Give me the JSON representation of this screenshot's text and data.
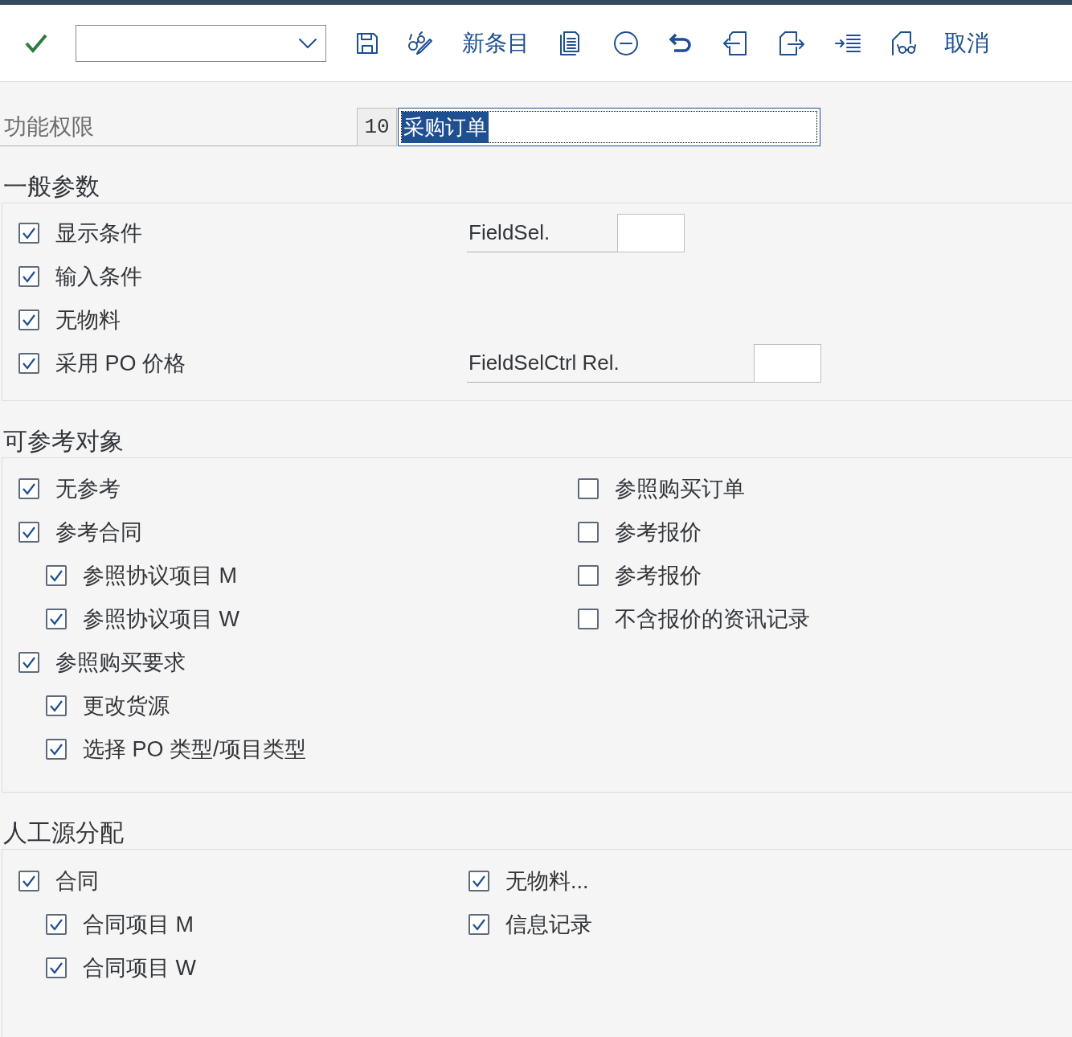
{
  "toolbar": {
    "new_entry": "新条目",
    "cancel": "取消"
  },
  "authority": {
    "label": "功能权限",
    "code": "10",
    "value": "采购订单",
    "text_selected": true
  },
  "sections": [
    {
      "title": "一般参数",
      "rows": [
        {
          "checkbox": {
            "label": "显示条件",
            "checked": true
          },
          "field": {
            "label": "FieldSel."
          }
        },
        {
          "checkbox": {
            "label": "输入条件",
            "checked": true
          }
        },
        {
          "checkbox": {
            "label": "无物料",
            "checked": true
          }
        },
        {
          "checkbox": {
            "label": "采用 PO 价格",
            "checked": true
          },
          "field": {
            "label": "FieldSelCtrl Rel."
          }
        }
      ]
    },
    {
      "title": "可参考对象",
      "left": [
        {
          "label": "无参考",
          "checked": true
        },
        {
          "label": "参考合同",
          "checked": true,
          "children": [
            {
              "label": "参照协议项目 M",
              "checked": true
            },
            {
              "label": "参照协议项目 W",
              "checked": true
            }
          ]
        },
        {
          "label": "参照购买要求",
          "checked": true,
          "children": [
            {
              "label": "更改货源",
              "checked": true
            },
            {
              "label": "选择 PO 类型/项目类型",
              "checked": true
            }
          ]
        }
      ],
      "right": [
        {
          "label": "参照购买订单",
          "checked": false
        },
        {
          "label": "参考报价",
          "checked": false
        },
        {
          "label": "参考报价",
          "checked": false
        },
        {
          "label": "不含报价的资讯记录",
          "checked": false
        }
      ]
    },
    {
      "title": "人工源分配",
      "left": [
        {
          "label": "合同",
          "checked": true,
          "children": [
            {
              "label": "合同项目 M",
              "checked": true
            },
            {
              "label": "合同项目 W",
              "checked": true
            }
          ]
        }
      ],
      "right": [
        {
          "label": "无物料...",
          "checked": true
        },
        {
          "label": "信息记录",
          "checked": true
        }
      ]
    }
  ]
}
